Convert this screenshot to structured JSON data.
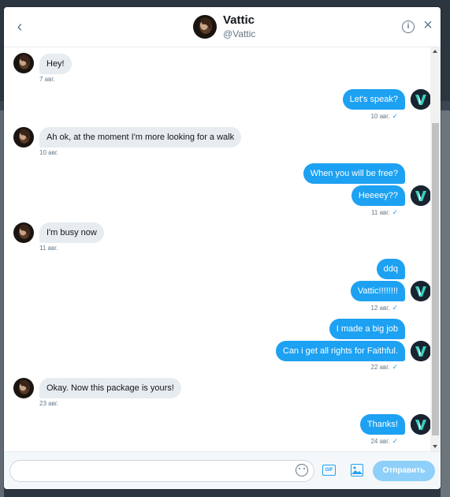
{
  "header": {
    "name": "Vattic",
    "handle": "@Vattic",
    "back_icon": "chevron-left-icon",
    "info_icon": "info-icon",
    "close_icon": "close-icon"
  },
  "messages": [
    {
      "dir": "in",
      "text": "Hey!",
      "time": "7 авг."
    },
    {
      "dir": "out",
      "text": "Let's speak?",
      "time": "10 авг."
    },
    {
      "dir": "in",
      "text": "Ah ok, at the moment I'm more looking for a walk",
      "time": "10 авг."
    },
    {
      "dir": "out",
      "text": "When you will be free?"
    },
    {
      "dir": "out",
      "text": "Heeeey??",
      "time": "11 авг."
    },
    {
      "dir": "in",
      "text": "I'm busy now",
      "time": "11 авг."
    },
    {
      "dir": "out",
      "text": "ddq"
    },
    {
      "dir": "out",
      "text": "Vattic!!!!!!!!",
      "time": "12 авг."
    },
    {
      "dir": "out",
      "text": "I made a big job"
    },
    {
      "dir": "out",
      "text": "Can i get all rights for Faithful.",
      "time": "22 авг."
    },
    {
      "dir": "in",
      "text": "Okay. Now this package is yours!",
      "time": "23 авг."
    },
    {
      "dir": "out",
      "text": "Thanks!",
      "time": "24 авг."
    }
  ],
  "composer": {
    "input_value": "",
    "send_label": "Отправить",
    "emoji_icon": "emoji-icon",
    "gif_icon": "gif-icon",
    "image_icon": "image-icon"
  },
  "colors": {
    "accent": "#1da1f2",
    "incoming_bubble": "#e6ecf0",
    "send_disabled": "#8ed0f9"
  }
}
